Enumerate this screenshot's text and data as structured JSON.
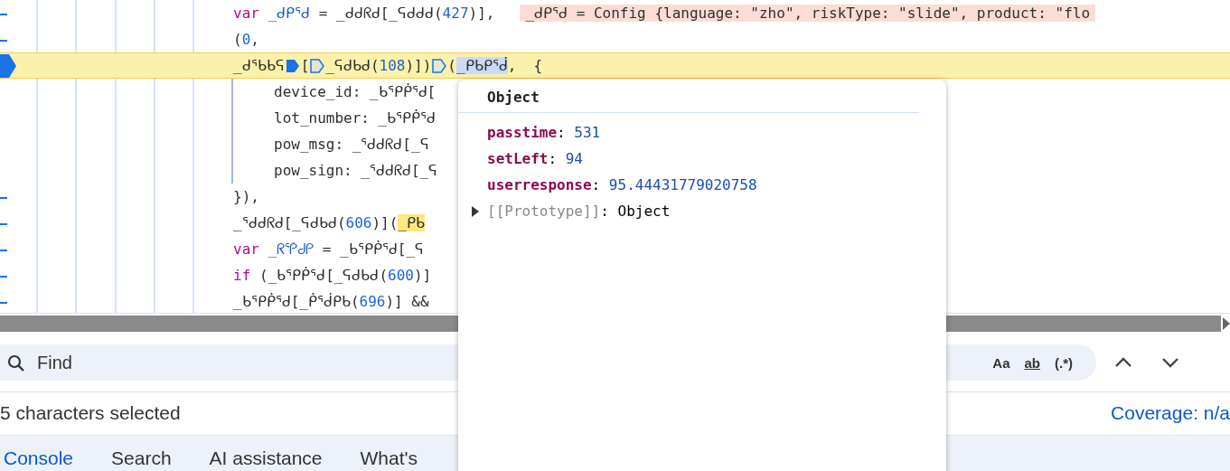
{
  "editor": {
    "lines": [
      {
        "paused": false,
        "tokens": [
          {
            "kind": "keyword",
            "text": "var "
          },
          {
            "kind": "decl",
            "text": "_ᑯᑭᕐᑯ"
          },
          {
            "kind": "plain",
            "text": " = _ᑯᑯᖇᑯ[_ᕋᑯᑯᑯ("
          },
          {
            "kind": "number",
            "text": "427"
          },
          {
            "kind": "plain",
            "text": ")],"
          },
          {
            "kind": "annotation",
            "text": "_ᑯᑭᕐᑯ = Config {language: \"zho\", riskType: \"slide\", product: \"flo"
          }
        ]
      },
      {
        "paused": false,
        "tokens": [
          {
            "kind": "plain",
            "text": "("
          },
          {
            "kind": "number",
            "text": "0"
          },
          {
            "kind": "plain",
            "text": ","
          }
        ]
      },
      {
        "paused": true,
        "tokens": [
          {
            "kind": "plain",
            "text": "_ᑯᕐᑲᑲᕋ"
          },
          {
            "kind": "breakpoint",
            "active": true
          },
          {
            "kind": "plain",
            "text": "["
          },
          {
            "kind": "breakpoint",
            "active": false
          },
          {
            "kind": "plain",
            "text": "_ᕋᑯᑲᑯ("
          },
          {
            "kind": "number",
            "text": "108"
          },
          {
            "kind": "plain",
            "text": ")])"
          },
          {
            "kind": "breakpoint",
            "active": false
          },
          {
            "kind": "plain",
            "text": "("
          },
          {
            "kind": "selection",
            "text": "_ᑭᑲᑭᕐᑰ"
          },
          {
            "kind": "plain",
            "text": ",  {"
          }
        ],
        "children": [
          {
            "paused": false,
            "tokens": [
              {
                "kind": "plain",
                "text": "device_id: _ᑲᕐᑭᑮᕐᑯ["
              }
            ]
          },
          {
            "paused": false,
            "tokens": [
              {
                "kind": "plain",
                "text": "lot_number: _ᑲᕐᑭᑮᕐᑯ"
              }
            ]
          },
          {
            "paused": false,
            "tokens": [
              {
                "kind": "plain",
                "text": "pow_msg: _ᕐᑯᑯᖇᑯ[_ᕋ"
              }
            ]
          },
          {
            "paused": false,
            "tokens": [
              {
                "kind": "plain",
                "text": "pow_sign: _ᕐᑯᑯᖇᑯ[_ᕋ"
              }
            ]
          }
        ]
      },
      {
        "paused": false,
        "tokens": [
          {
            "kind": "plain",
            "text": "}),"
          }
        ]
      },
      {
        "paused": false,
        "tokens": [
          {
            "kind": "plain",
            "text": "_ᕐᑯᑯᖇᑯ[_ᕋᑯᑲᑯ("
          },
          {
            "kind": "number",
            "text": "606"
          },
          {
            "kind": "plain",
            "text": ")]("
          },
          {
            "kind": "match",
            "text": "_ᑭᑲ"
          }
        ]
      },
      {
        "paused": false,
        "tokens": [
          {
            "kind": "keyword",
            "text": "var "
          },
          {
            "kind": "decl",
            "text": "_ᖇᕐᑮᑯᑭ"
          },
          {
            "kind": "plain",
            "text": " = _ᑲᕐᑭᑮᕐᑯ[_ᕋ"
          }
        ]
      },
      {
        "paused": false,
        "tokens": [
          {
            "kind": "keyword",
            "text": "if"
          },
          {
            "kind": "plain",
            "text": " (_ᑲᕐᑭᑮᕐᑯ[_ᕋᑯᑲᑯ("
          },
          {
            "kind": "number",
            "text": "600"
          },
          {
            "kind": "plain",
            "text": ")]"
          }
        ]
      },
      {
        "paused": false,
        "tokens": [
          {
            "kind": "plain",
            "text": "_ᑲᕐᑭᑮᕐᑯ[_ᑮᕐᑰᑭᑲ("
          },
          {
            "kind": "number",
            "text": "696"
          },
          {
            "kind": "plain",
            "text": ")] &&"
          }
        ]
      }
    ]
  },
  "popover": {
    "title": "Object",
    "properties": [
      {
        "name": "passtime",
        "separator": ":",
        "value": "531"
      },
      {
        "name": "setLeft",
        "separator": ":",
        "value": "94"
      },
      {
        "name": "userresponse",
        "separator": ":",
        "value": "95.44431779020758"
      }
    ],
    "prototype": {
      "label": "[[Prototype]]",
      "separator": ":",
      "value": "Object",
      "expanded": false
    }
  },
  "find": {
    "placeholder": "Find",
    "options": [
      "Aa",
      "ab",
      "(.*)"
    ]
  },
  "status_bar": {
    "selection": "5 characters selected",
    "coverage": "Coverage: n/a"
  },
  "drawer_tabs": [
    {
      "label": "Console",
      "selected": true
    },
    {
      "label": "Search",
      "selected": false
    },
    {
      "label": "AI assistance",
      "selected": false
    },
    {
      "label": "What's",
      "selected": false
    }
  ]
}
